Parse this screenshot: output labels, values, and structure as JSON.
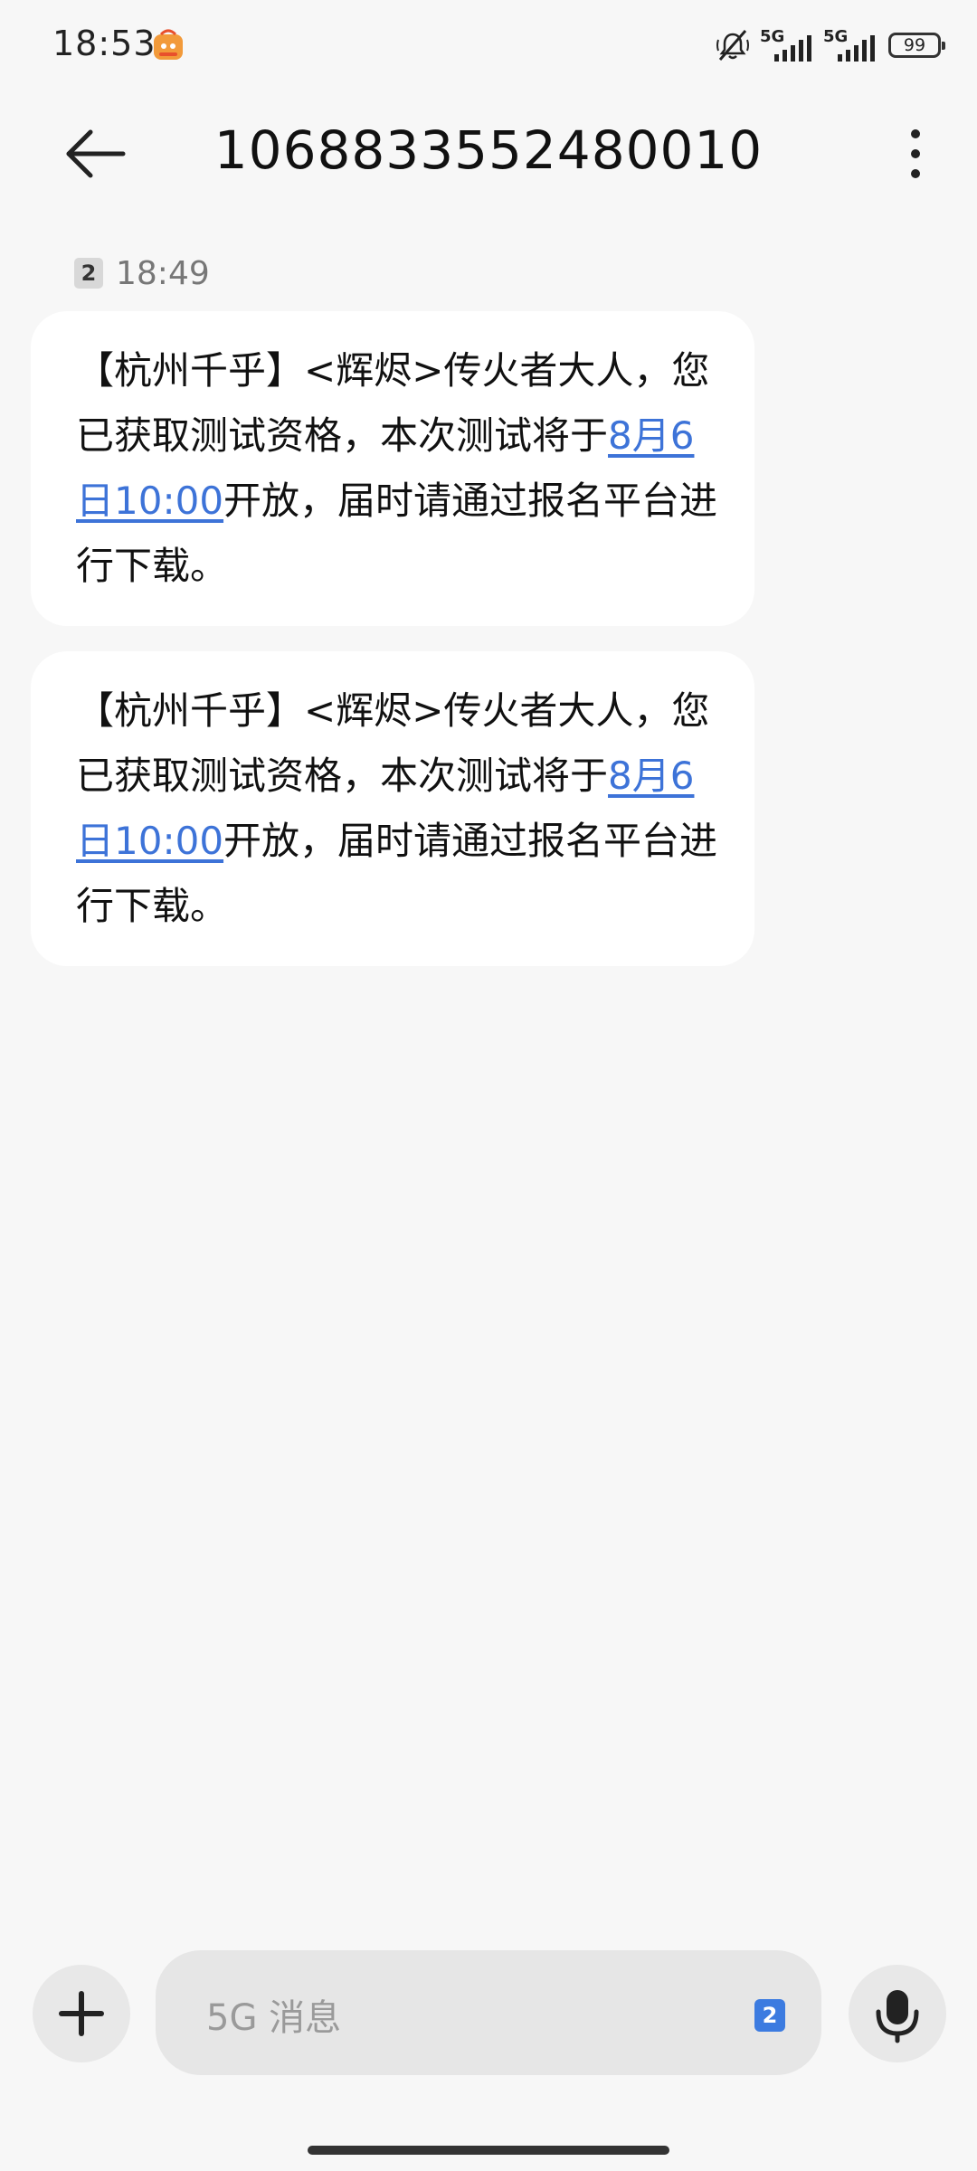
{
  "status_bar": {
    "time": "18:53",
    "app_icon": "shopping-app-icon",
    "icons": [
      "mute-icon",
      "signal-5g-icon",
      "signal-5g-icon"
    ],
    "signal1_label": "5G",
    "signal2_label": "5G",
    "battery": "99"
  },
  "header": {
    "title": "1068833552480010",
    "back_icon": "arrow-left-icon",
    "more_icon": "more-vertical-icon"
  },
  "conversation": {
    "sim_slot": "2",
    "timestamp": "18:49",
    "messages": [
      {
        "text_before": "【杭州千乎】<辉烬>传火者大人，您已获取测试资格，本次测试将于",
        "link": "8月6日10:00",
        "text_after": "开放，届时请通过报名平台进行下载。"
      },
      {
        "text_before": "【杭州千乎】<辉烬>传火者大人，您已获取测试资格，本次测试将于",
        "link": "8月6日10:00",
        "text_after": "开放，届时请通过报名平台进行下载。"
      }
    ]
  },
  "composer": {
    "add_icon": "plus-icon",
    "placeholder": "5G 消息",
    "sim_slot": "2",
    "mic_icon": "microphone-icon"
  },
  "colors": {
    "background": "#f7f7f7",
    "bubble": "#ffffff",
    "link": "#3d73d8",
    "sim_badge": "#3c7be0"
  }
}
